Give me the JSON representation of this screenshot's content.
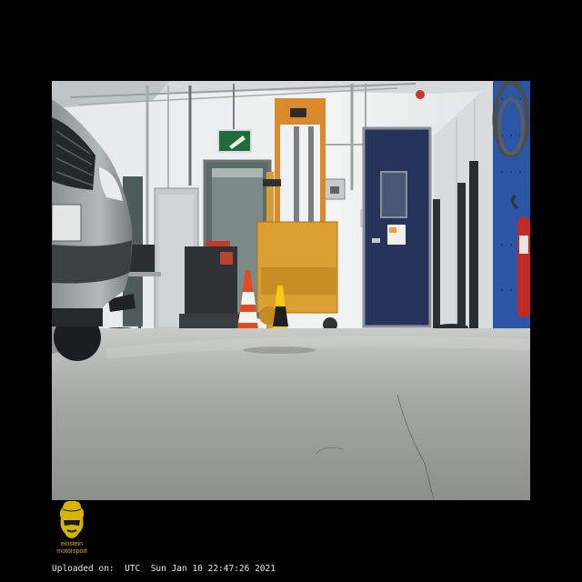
{
  "photo": {
    "description_icon": "garage-scene-photo"
  },
  "logo": {
    "text_line1": "einstein",
    "text_line2": "motorsport",
    "accent_color": "#d6b400"
  },
  "upload": {
    "label": "Uploaded on:",
    "timestamp": "UTC  Sun Jan 10 22:47:26 2021"
  }
}
